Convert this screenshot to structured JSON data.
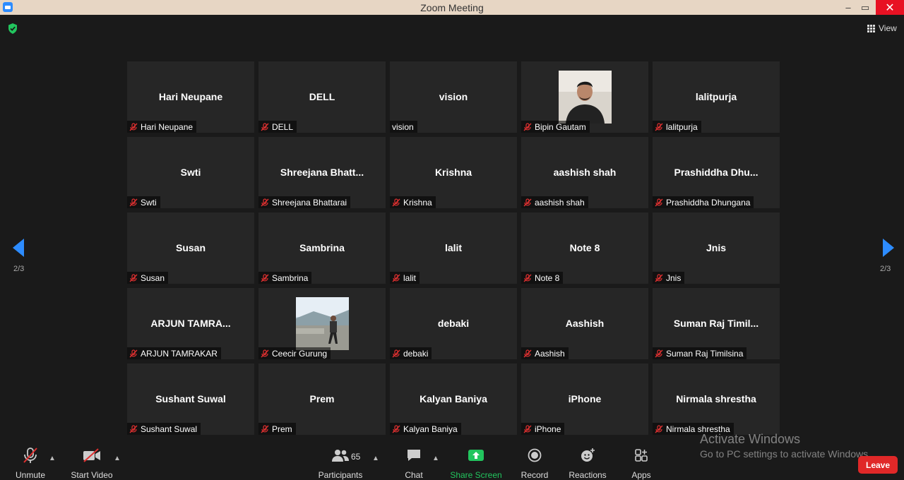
{
  "window": {
    "title": "Zoom Meeting",
    "minimize": "–",
    "maximize": "▭",
    "close": "✕"
  },
  "header": {
    "view_label": "View"
  },
  "pagination": {
    "left": "2/3",
    "right": "2/3"
  },
  "tiles": [
    {
      "big": "Hari Neupane",
      "label": "Hari Neupane",
      "muted": true
    },
    {
      "big": "DELL",
      "label": "DELL",
      "muted": true
    },
    {
      "big": "vision",
      "label": "vision",
      "muted": false
    },
    {
      "big": "",
      "label": "Bipin Gautam",
      "muted": true,
      "photo": "portrait"
    },
    {
      "big": "lalitpurja",
      "label": "lalitpurja",
      "muted": true
    },
    {
      "big": "Swti",
      "label": "Swti",
      "muted": true
    },
    {
      "big": "Shreejana  Bhatt...",
      "label": "Shreejana Bhattarai",
      "muted": true
    },
    {
      "big": "Krishna",
      "label": "Krishna",
      "muted": true
    },
    {
      "big": "aashish shah",
      "label": "aashish shah",
      "muted": true
    },
    {
      "big": "Prashiddha  Dhu...",
      "label": "Prashiddha Dhungana",
      "muted": true
    },
    {
      "big": "Susan",
      "label": "Susan",
      "muted": true
    },
    {
      "big": "Sambrina",
      "label": "Sambrina",
      "muted": true
    },
    {
      "big": "lalit",
      "label": "lalit",
      "muted": true
    },
    {
      "big": "Note 8",
      "label": "Note 8",
      "muted": true
    },
    {
      "big": "Jnis",
      "label": "Jnis",
      "muted": true
    },
    {
      "big": "ARJUN  TAMRA...",
      "label": "ARJUN TAMRAKAR",
      "muted": true
    },
    {
      "big": "",
      "label": "Ceecir Gurung",
      "muted": true,
      "photo": "outdoor"
    },
    {
      "big": "debaki",
      "label": "debaki",
      "muted": true
    },
    {
      "big": "Aashish",
      "label": "Aashish",
      "muted": true
    },
    {
      "big": "Suman  Raj  Timil...",
      "label": "Suman Raj Timilsina",
      "muted": true
    },
    {
      "big": "Sushant Suwal",
      "label": "Sushant Suwal",
      "muted": true
    },
    {
      "big": "Prem",
      "label": "Prem",
      "muted": true
    },
    {
      "big": "Kalyan Baniya",
      "label": "Kalyan Baniya",
      "muted": true
    },
    {
      "big": "iPhone",
      "label": "iPhone",
      "muted": true
    },
    {
      "big": "Nirmala shrestha",
      "label": "Nirmala shrestha",
      "muted": true
    }
  ],
  "toolbar": {
    "unmute": "Unmute",
    "start_video": "Start Video",
    "participants": "Participants",
    "participants_count": "65",
    "chat": "Chat",
    "share_screen": "Share Screen",
    "record": "Record",
    "reactions": "Reactions",
    "apps": "Apps",
    "leave": "Leave"
  },
  "watermark": {
    "line1": "Activate Windows",
    "line2": "Go to PC settings to activate Windows."
  },
  "colors": {
    "accent": "#2d8cff",
    "muted_mic": "#e03030",
    "share": "#22c55e",
    "leave": "#e02828"
  }
}
